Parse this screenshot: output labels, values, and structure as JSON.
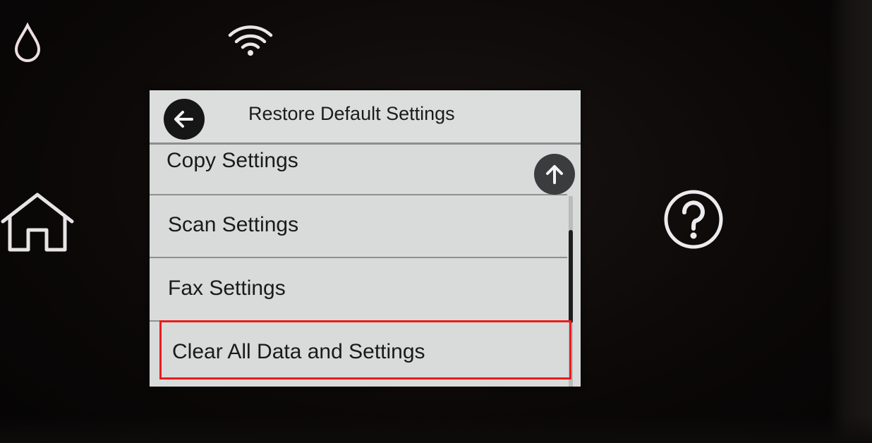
{
  "screen": {
    "title": "Restore Default Settings",
    "menu_items": [
      {
        "label": "Copy Settings"
      },
      {
        "label": "Scan Settings"
      },
      {
        "label": "Fax Settings"
      },
      {
        "label": "Clear All Data and Settings"
      }
    ],
    "highlighted_item": "Clear All Data and Settings"
  },
  "colors": {
    "highlight": "#ea1c1c",
    "screen_background": "#d9dbda",
    "hardware_background": "#0c0908"
  },
  "icons": {
    "ink": "ink-drop-icon",
    "wifi": "wifi-icon",
    "home": "home-icon",
    "help": "help-icon",
    "back": "back-arrow-icon",
    "scroll_up": "arrow-up-icon"
  }
}
